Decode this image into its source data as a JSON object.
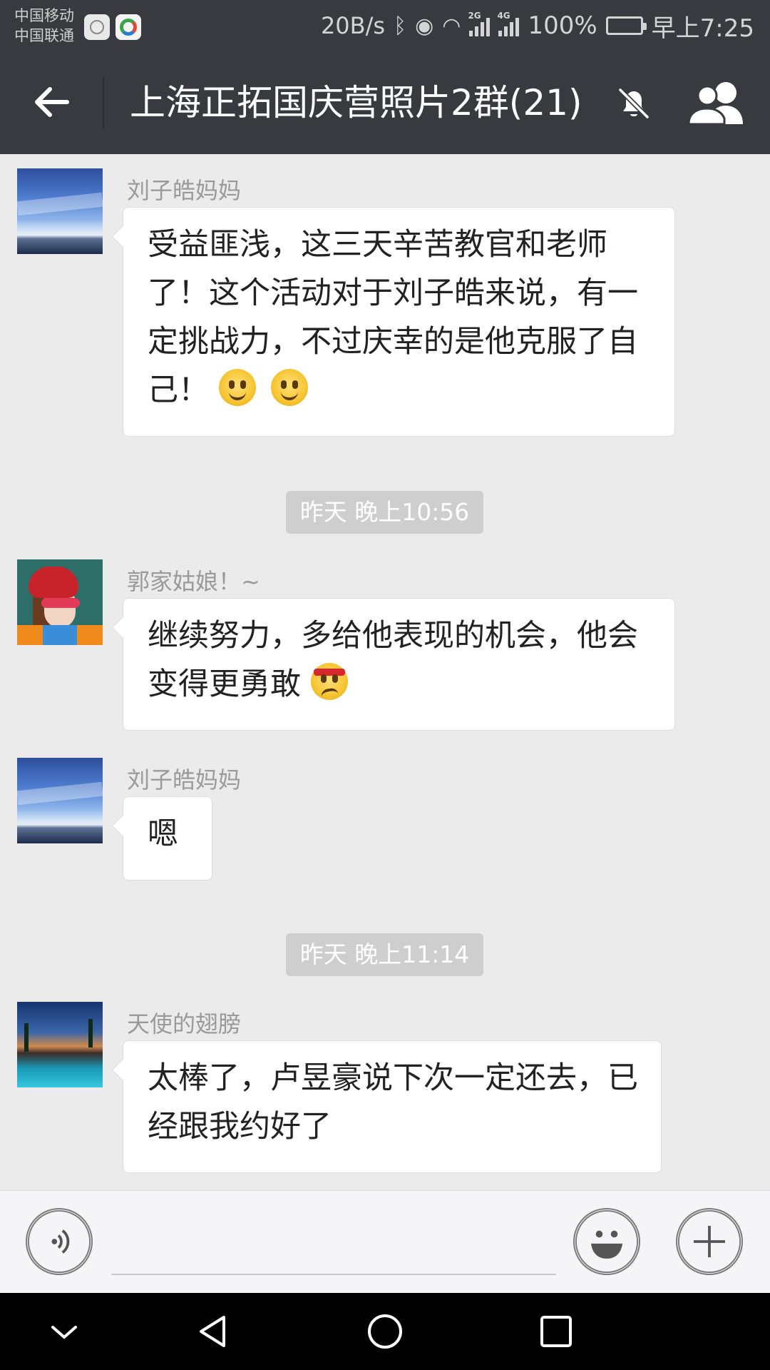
{
  "status_bar": {
    "carrier_1": "中国移动",
    "carrier_2": "中国联通",
    "speed": "20B/s",
    "net_2g": "2G",
    "net_4g": "4G",
    "battery": "100%",
    "time": "早上7:25"
  },
  "header": {
    "title": "上海正拓国庆营照片2群(21)",
    "icons": [
      "back-arrow-icon",
      "mute-bell-icon",
      "members-icon"
    ]
  },
  "messages": [
    {
      "sender": "刘子皓妈妈",
      "text": "受益匪浅，这三天辛苦教官和老师了！这个活动对于刘子皓来说，有一定挑战力，不过庆幸的是他克服了自己！",
      "emojis": [
        "smile-emoji",
        "smile-emoji"
      ]
    },
    {
      "timestamp": "昨天 晚上10:56"
    },
    {
      "sender": "郭家姑娘！~",
      "text": "继续努力，多给他表现的机会，他会变得更勇敢",
      "emojis": [
        "determined-emoji"
      ]
    },
    {
      "sender": "刘子皓妈妈",
      "text": "嗯"
    },
    {
      "timestamp": "昨天 晚上11:14"
    },
    {
      "sender": "天使的翅膀",
      "text": "太棒了，卢昱豪说下次一定还去，已经跟我约好了"
    }
  ],
  "input_bar": {
    "icons": [
      "voice-icon",
      "emoji-icon",
      "plus-icon"
    ]
  },
  "nav_bar": {
    "icons": [
      "nav-down-icon",
      "nav-back-icon",
      "nav-home-icon",
      "nav-recent-icon"
    ]
  },
  "colors": {
    "header_bg": "#393a3f",
    "chat_bg": "#ebebeb",
    "bubble_bg": "#ffffff",
    "timestamp_bg": "#cecece"
  }
}
